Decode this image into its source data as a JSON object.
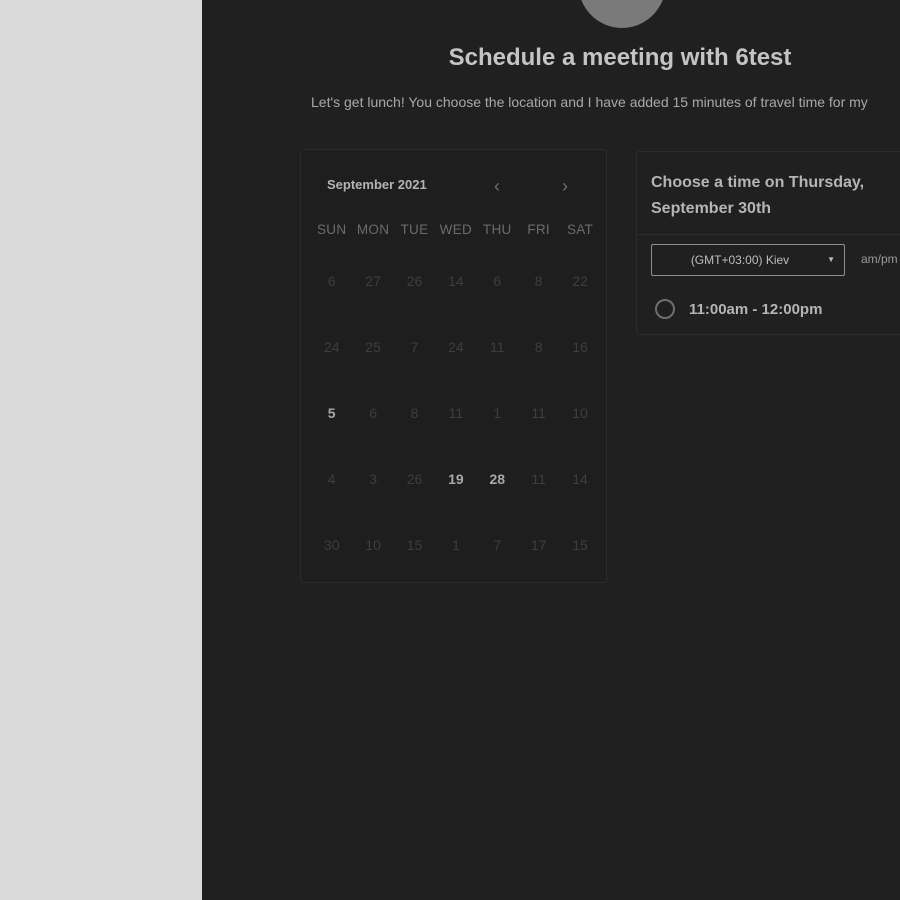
{
  "header": {
    "title": "Schedule a meeting with 6test",
    "description": "Let's get lunch! You choose the location and I have added 15 minutes of travel time for my"
  },
  "calendar": {
    "month_label": "September 2021",
    "prev_icon": "chevron-left-icon",
    "next_icon": "chevron-right-icon",
    "prev_glyph": "‹",
    "next_glyph": "›",
    "weekdays": [
      "SUN",
      "MON",
      "TUE",
      "WED",
      "THU",
      "FRI",
      "SAT"
    ],
    "weeks": [
      [
        "6",
        "27",
        "26",
        "14",
        "6",
        "8",
        "22"
      ],
      [
        "24",
        "25",
        "7",
        "24",
        "11",
        "8",
        "16"
      ],
      [
        "5",
        "6",
        "8",
        "11",
        "1",
        "11",
        "10"
      ],
      [
        "4",
        "3",
        "26",
        "19",
        "28",
        "11",
        "14"
      ],
      [
        "30",
        "10",
        "15",
        "1",
        "7",
        "17",
        "15"
      ]
    ],
    "available_days": [
      "5",
      "19",
      "28"
    ]
  },
  "time_panel": {
    "title": "Choose a time on Thursday, September 30th",
    "timezone": "(GMT+03:00) Kiev",
    "timezone_caret_icon": "caret-down-icon",
    "format_toggle": "am/pm",
    "slots": [
      {
        "label": "11:00am - 12:00pm"
      }
    ]
  },
  "colors": {
    "background": "#202020",
    "sidebar": "#dadada",
    "text_primary": "#c4c4c4",
    "text_muted": "#3e3e3e"
  }
}
